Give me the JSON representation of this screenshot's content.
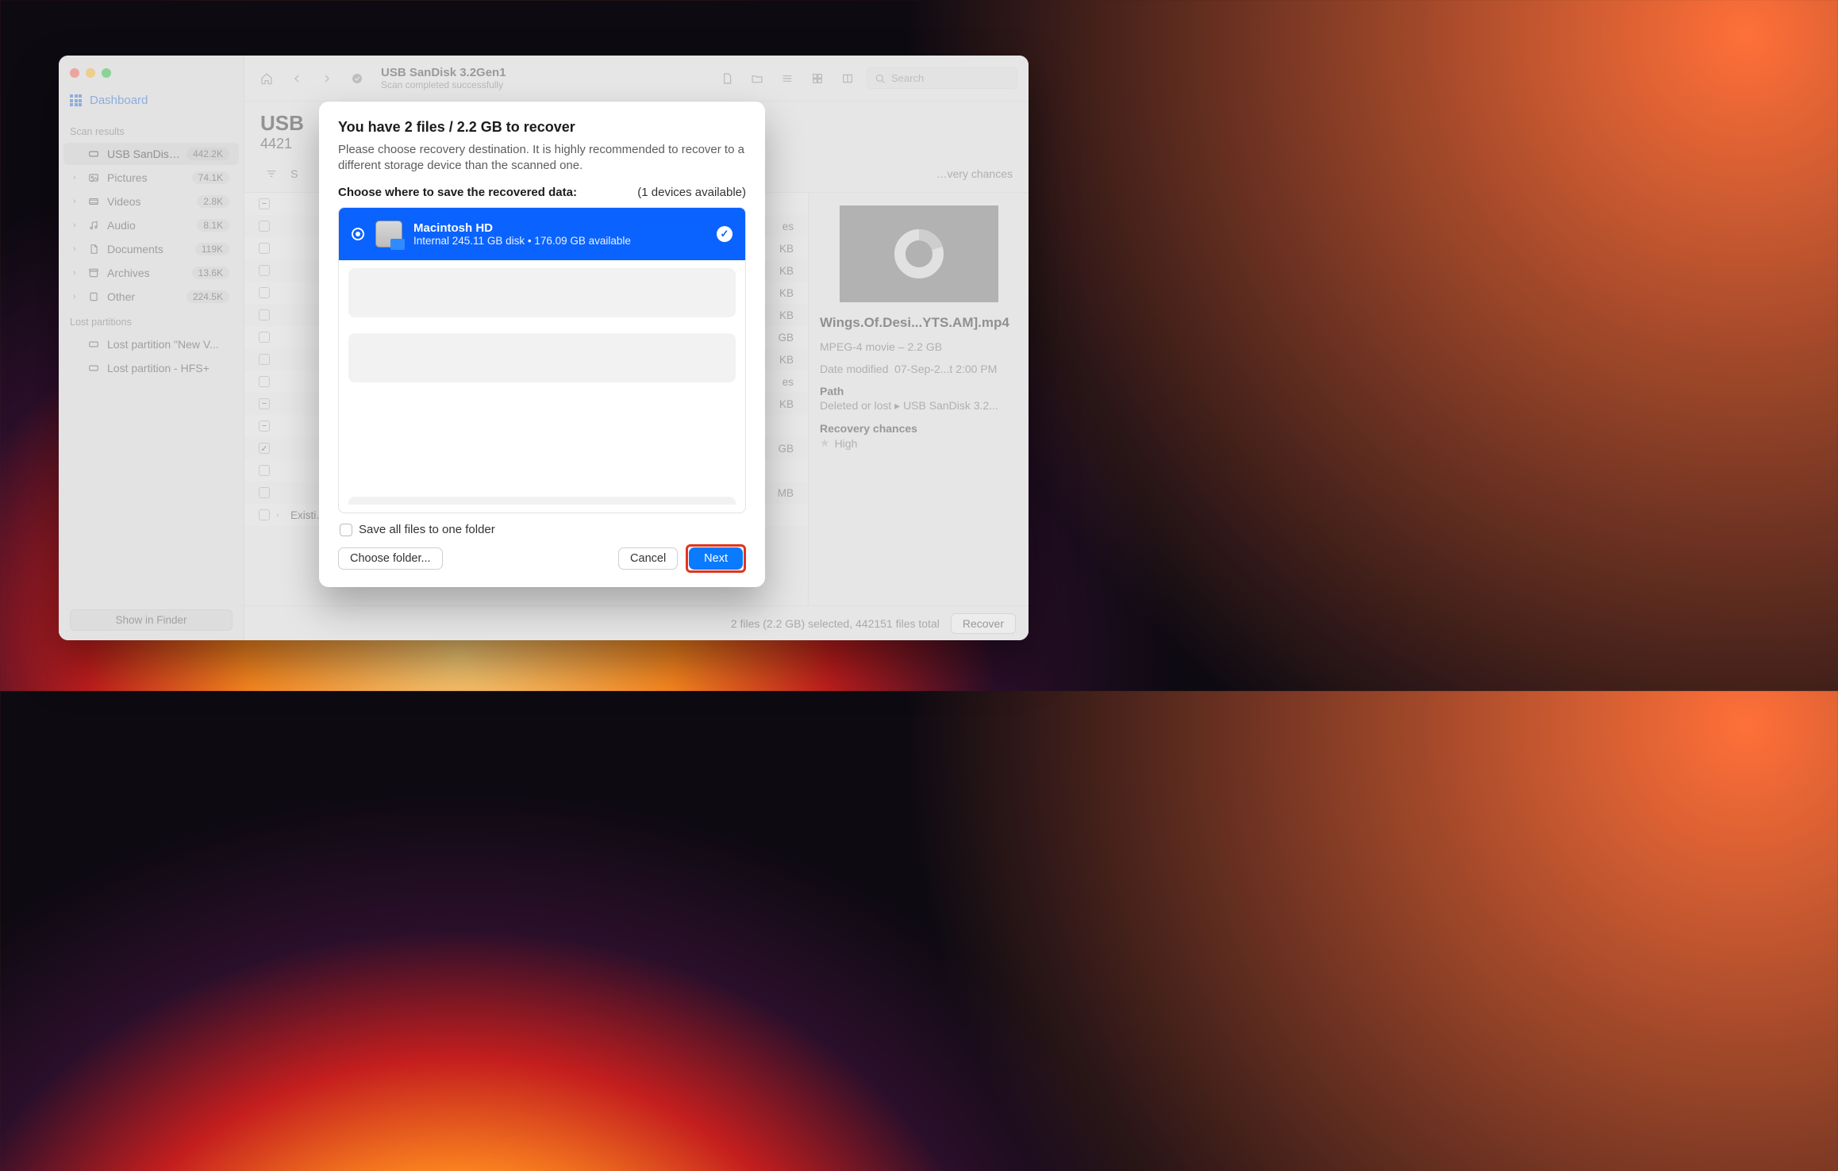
{
  "sidebar": {
    "dashboard_label": "Dashboard",
    "scan_results_label": "Scan results",
    "items": [
      {
        "label": "USB  SanDisk...",
        "badge": "442.2K",
        "icon": "drive"
      },
      {
        "label": "Pictures",
        "badge": "74.1K",
        "icon": "pictures",
        "expandable": true
      },
      {
        "label": "Videos",
        "badge": "2.8K",
        "icon": "videos",
        "expandable": true
      },
      {
        "label": "Audio",
        "badge": "8.1K",
        "icon": "audio",
        "expandable": true
      },
      {
        "label": "Documents",
        "badge": "119K",
        "icon": "documents",
        "expandable": true
      },
      {
        "label": "Archives",
        "badge": "13.6K",
        "icon": "archives",
        "expandable": true
      },
      {
        "label": "Other",
        "badge": "224.5K",
        "icon": "other",
        "expandable": true
      }
    ],
    "lost_partitions_label": "Lost partitions",
    "lost_partitions": [
      {
        "label": "Lost partition \"New V..."
      },
      {
        "label": "Lost partition - HFS+"
      }
    ],
    "show_in_finder": "Show in Finder"
  },
  "toolbar": {
    "title": "USB  SanDisk 3.2Gen1",
    "subtitle": "Scan completed successfully",
    "search_placeholder": "Search"
  },
  "header": {
    "title_visible": "USB",
    "subtitle_visible": "4421"
  },
  "filter_bar": {
    "filter_char": "S",
    "right_label": "…very chances"
  },
  "file_rows": [
    {
      "kind": "minus",
      "size": ""
    },
    {
      "kind": "empty",
      "size": "es"
    },
    {
      "kind": "empty",
      "size": "KB"
    },
    {
      "kind": "empty",
      "size": "KB"
    },
    {
      "kind": "empty",
      "size": "KB"
    },
    {
      "kind": "empty",
      "size": "KB"
    },
    {
      "kind": "empty",
      "size": "GB"
    },
    {
      "kind": "empty",
      "size": "KB"
    },
    {
      "kind": "empty",
      "size": "es"
    },
    {
      "kind": "minus",
      "size": "KB"
    },
    {
      "kind": "minus",
      "size": ""
    },
    {
      "kind": "check",
      "size": "GB"
    },
    {
      "kind": "empty",
      "size": ""
    },
    {
      "kind": "empty",
      "size": "MB"
    },
    {
      "kind": "expand",
      "label": "Existi…",
      "size": ""
    }
  ],
  "preview": {
    "filename": "Wings.Of.Desi...YTS.AM].mp4",
    "type_size": "MPEG-4 movie – 2.2 GB",
    "date_label_prefix": "Date modified",
    "date_value": "07-Sep-2...t 2:00 PM",
    "path_label": "Path",
    "path_value": "Deleted or lost ▸ USB  SanDisk 3.2...",
    "recovery_label": "Recovery chances",
    "recovery_value": "High"
  },
  "status_bar": {
    "summary": "2 files (2.2 GB) selected, 442151 files total",
    "recover": "Recover"
  },
  "modal": {
    "heading": "You have 2 files / 2.2 GB to recover",
    "description": "Please choose recovery destination. It is highly recommended to recover to a different storage device than the scanned one.",
    "choose_label": "Choose where to save the recovered data:",
    "devices_available": "(1 devices available)",
    "device": {
      "name": "Macintosh HD",
      "details": "Internal 245.11 GB disk • 176.09 GB available"
    },
    "save_all_label": "Save all files to one folder",
    "choose_folder": "Choose folder...",
    "cancel": "Cancel",
    "next": "Next"
  }
}
